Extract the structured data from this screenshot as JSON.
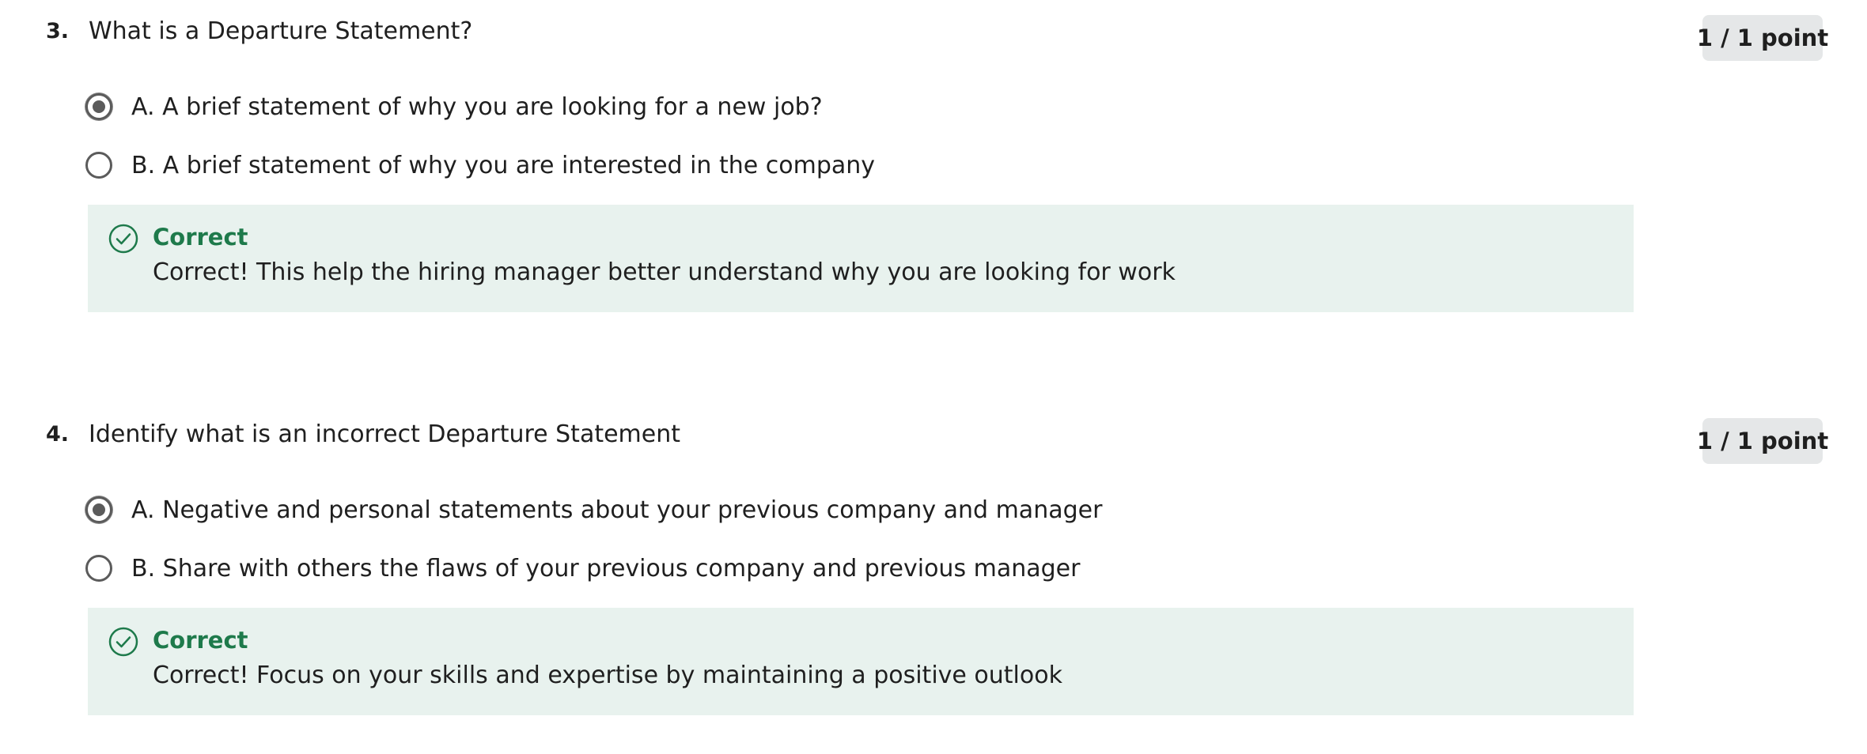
{
  "questions": [
    {
      "number": "3.",
      "text": "What is a Departure Statement?",
      "points": "1 / 1 point",
      "options": [
        {
          "label": "A. A brief statement of why you are looking for a new job?",
          "selected": true
        },
        {
          "label": "B. A brief statement of why you are interested in the company",
          "selected": false
        }
      ],
      "feedback": {
        "title": "Correct",
        "text": "Correct! This help the hiring manager better understand why you are looking for work",
        "icon": "check-circle-icon",
        "color": "#1e7a4b",
        "background": "#e8f2ee"
      }
    },
    {
      "number": "4.",
      "text": "Identify what is an incorrect Departure Statement",
      "points": "1 / 1 point",
      "options": [
        {
          "label": "A. Negative and personal statements about your previous company and manager",
          "selected": true
        },
        {
          "label": "B. Share with others the flaws of your previous company and previous manager",
          "selected": false
        }
      ],
      "feedback": {
        "title": "Correct",
        "text": "Correct! Focus on your skills and expertise by maintaining a positive outlook",
        "icon": "check-circle-icon",
        "color": "#1e7a4b",
        "background": "#e8f2ee"
      }
    }
  ]
}
